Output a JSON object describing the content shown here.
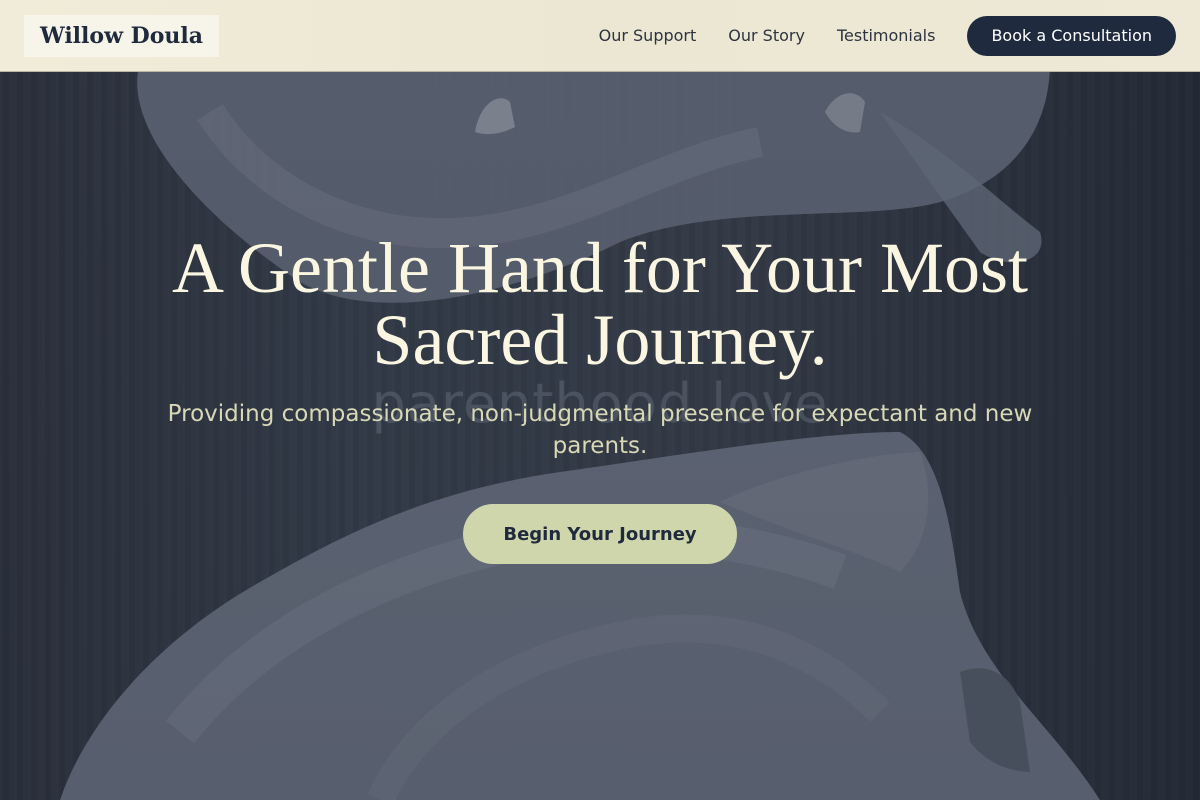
{
  "brand": {
    "logo_text": "Willow Doula"
  },
  "nav": {
    "links": [
      "Our Support",
      "Our Story",
      "Testimonials"
    ],
    "cta_label": "Book a Consultation"
  },
  "hero": {
    "title": "A Gentle Hand for Your Most Sacred Journey.",
    "subtitle": "Providing compassionate, non-judgmental presence for expectant and new parents.",
    "cta_label": "Begin Your Journey",
    "background_watermark": "parenthood love",
    "photo": "newborn wrapped in soft blanket",
    "photo_alt": "Newborn swaddled in a soft blanket, photographed on wood"
  },
  "colors": {
    "header_bg": "#ece8d4",
    "primary_dark": "#1f2a3e",
    "title_cream": "#fbf6e2",
    "accent_sage": "#d0d6ac",
    "hero_bg": "#2b3240"
  }
}
